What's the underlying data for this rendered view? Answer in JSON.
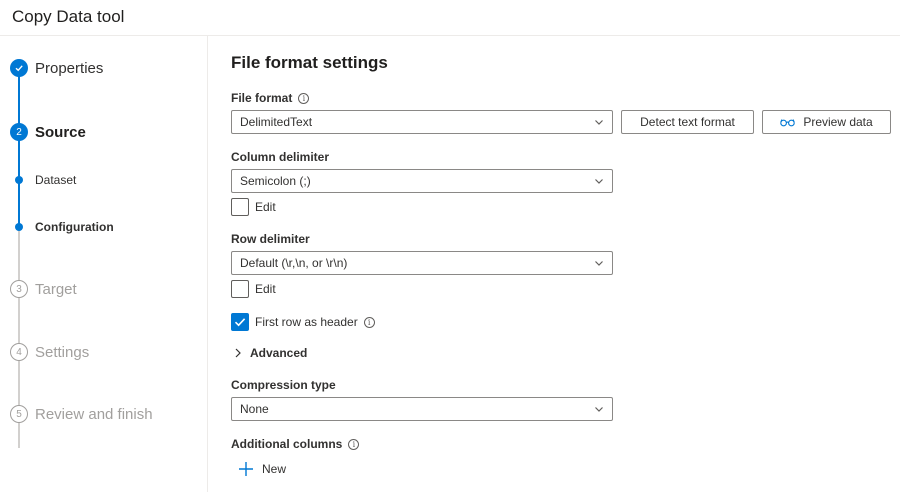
{
  "app": {
    "title": "Copy Data tool"
  },
  "wizard": {
    "steps": [
      {
        "number": "✓",
        "label": "Properties",
        "state": "done"
      },
      {
        "number": "2",
        "label": "Source",
        "state": "active"
      },
      {
        "number": "3",
        "label": "Target",
        "state": "pending"
      },
      {
        "number": "4",
        "label": "Settings",
        "state": "pending"
      },
      {
        "number": "5",
        "label": "Review and finish",
        "state": "pending"
      }
    ],
    "substeps": [
      {
        "label": "Dataset",
        "current": false
      },
      {
        "label": "Configuration",
        "current": true
      }
    ]
  },
  "form": {
    "heading": "File format settings",
    "file_format": {
      "label": "File format",
      "value": "DelimitedText"
    },
    "detect_button": "Detect text format",
    "preview_button": "Preview data",
    "column_delimiter": {
      "label": "Column delimiter",
      "value": "Semicolon (;)",
      "edit_label": "Edit",
      "edit_checked": false
    },
    "row_delimiter": {
      "label": "Row delimiter",
      "value": "Default (\\r,\\n, or \\r\\n)",
      "edit_label": "Edit",
      "edit_checked": false
    },
    "first_row_header": {
      "label": "First row as header",
      "checked": true
    },
    "advanced_label": "Advanced",
    "compression": {
      "label": "Compression type",
      "value": "None"
    },
    "additional_columns": {
      "label": "Additional columns",
      "new_label": "New"
    }
  },
  "colors": {
    "accent": "#0078d4",
    "inactive": "#a19f9d"
  }
}
